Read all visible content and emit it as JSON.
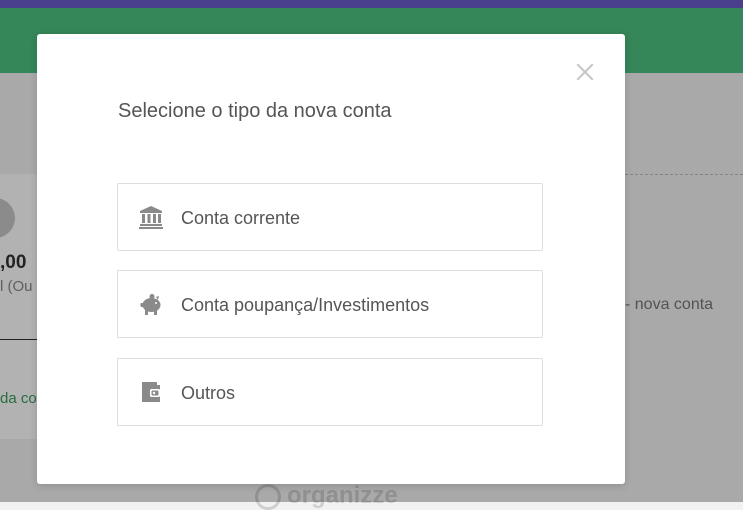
{
  "background": {
    "header_text": "",
    "card_amount": ",00",
    "card_sub": "l (Ou",
    "card_link": "da co",
    "add_account_text": "- nova conta",
    "brand": "organizze"
  },
  "modal": {
    "title": "Selecione o tipo da nova conta",
    "options": [
      {
        "label": "Conta corrente",
        "icon": "bank-icon"
      },
      {
        "label": "Conta poupança/Investimentos",
        "icon": "piggy-bank-icon"
      },
      {
        "label": "Outros",
        "icon": "wallet-icon"
      }
    ]
  },
  "colors": {
    "accent_purple": "#6a5bc9",
    "header_green": "#4cc07e",
    "icon_gray": "#8a8a8a",
    "text_gray": "#555555"
  }
}
